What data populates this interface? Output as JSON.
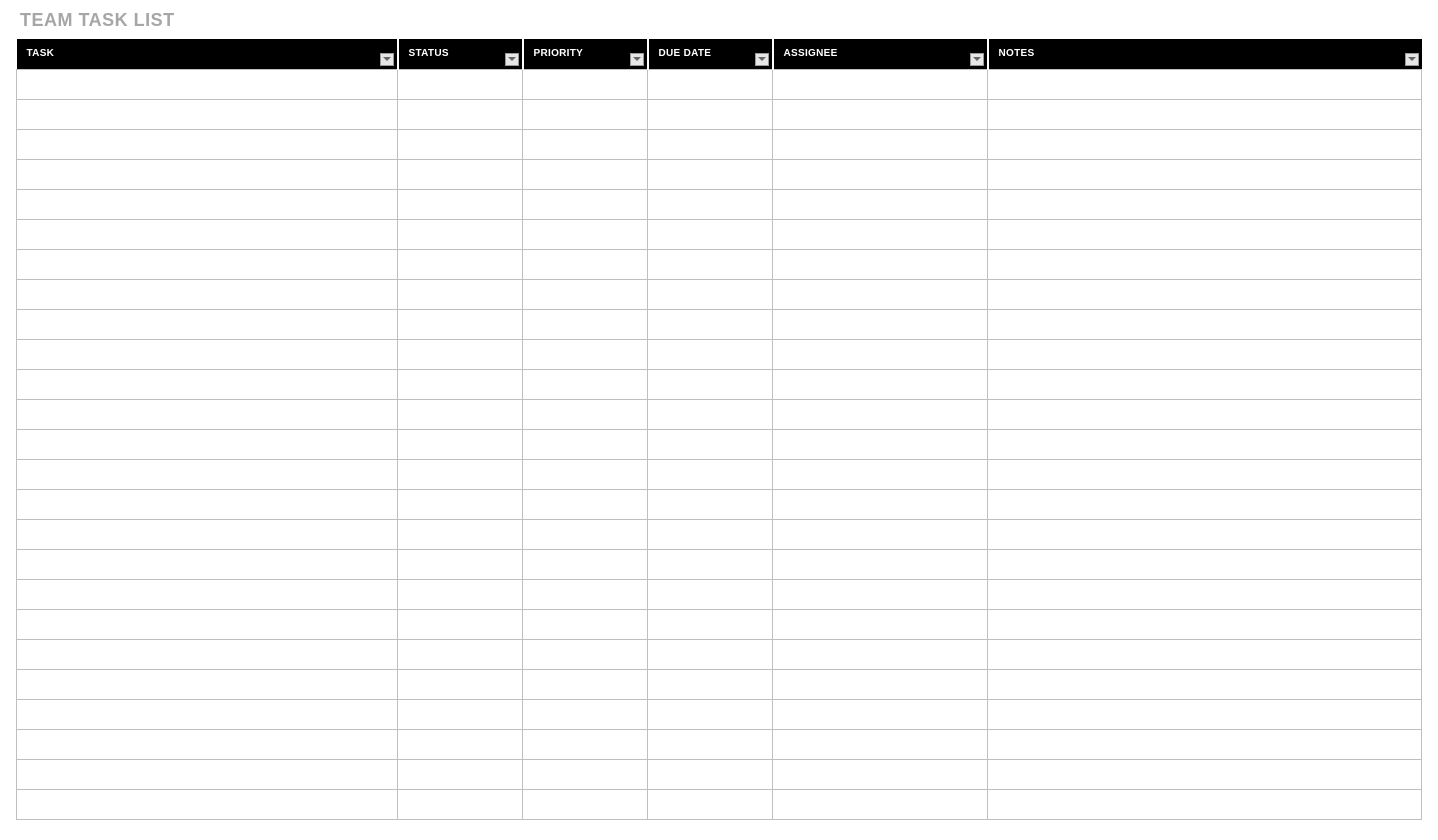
{
  "title": "TEAM TASK LIST",
  "columns": [
    {
      "key": "task",
      "label": "TASK",
      "filterable": true
    },
    {
      "key": "status",
      "label": "STATUS",
      "filterable": true
    },
    {
      "key": "priority",
      "label": "PRIORITY",
      "filterable": true
    },
    {
      "key": "due_date",
      "label": "DUE DATE",
      "filterable": true
    },
    {
      "key": "assignee",
      "label": "ASSIGNEE",
      "filterable": true
    },
    {
      "key": "notes",
      "label": "NOTES",
      "filterable": true
    }
  ],
  "rows": [
    {
      "task": "",
      "status": "",
      "priority": "",
      "due_date": "",
      "assignee": "",
      "notes": ""
    },
    {
      "task": "",
      "status": "",
      "priority": "",
      "due_date": "",
      "assignee": "",
      "notes": ""
    },
    {
      "task": "",
      "status": "",
      "priority": "",
      "due_date": "",
      "assignee": "",
      "notes": ""
    },
    {
      "task": "",
      "status": "",
      "priority": "",
      "due_date": "",
      "assignee": "",
      "notes": ""
    },
    {
      "task": "",
      "status": "",
      "priority": "",
      "due_date": "",
      "assignee": "",
      "notes": ""
    },
    {
      "task": "",
      "status": "",
      "priority": "",
      "due_date": "",
      "assignee": "",
      "notes": ""
    },
    {
      "task": "",
      "status": "",
      "priority": "",
      "due_date": "",
      "assignee": "",
      "notes": ""
    },
    {
      "task": "",
      "status": "",
      "priority": "",
      "due_date": "",
      "assignee": "",
      "notes": ""
    },
    {
      "task": "",
      "status": "",
      "priority": "",
      "due_date": "",
      "assignee": "",
      "notes": ""
    },
    {
      "task": "",
      "status": "",
      "priority": "",
      "due_date": "",
      "assignee": "",
      "notes": ""
    },
    {
      "task": "",
      "status": "",
      "priority": "",
      "due_date": "",
      "assignee": "",
      "notes": ""
    },
    {
      "task": "",
      "status": "",
      "priority": "",
      "due_date": "",
      "assignee": "",
      "notes": ""
    },
    {
      "task": "",
      "status": "",
      "priority": "",
      "due_date": "",
      "assignee": "",
      "notes": ""
    },
    {
      "task": "",
      "status": "",
      "priority": "",
      "due_date": "",
      "assignee": "",
      "notes": ""
    },
    {
      "task": "",
      "status": "",
      "priority": "",
      "due_date": "",
      "assignee": "",
      "notes": ""
    },
    {
      "task": "",
      "status": "",
      "priority": "",
      "due_date": "",
      "assignee": "",
      "notes": ""
    },
    {
      "task": "",
      "status": "",
      "priority": "",
      "due_date": "",
      "assignee": "",
      "notes": ""
    },
    {
      "task": "",
      "status": "",
      "priority": "",
      "due_date": "",
      "assignee": "",
      "notes": ""
    },
    {
      "task": "",
      "status": "",
      "priority": "",
      "due_date": "",
      "assignee": "",
      "notes": ""
    },
    {
      "task": "",
      "status": "",
      "priority": "",
      "due_date": "",
      "assignee": "",
      "notes": ""
    },
    {
      "task": "",
      "status": "",
      "priority": "",
      "due_date": "",
      "assignee": "",
      "notes": ""
    },
    {
      "task": "",
      "status": "",
      "priority": "",
      "due_date": "",
      "assignee": "",
      "notes": ""
    },
    {
      "task": "",
      "status": "",
      "priority": "",
      "due_date": "",
      "assignee": "",
      "notes": ""
    },
    {
      "task": "",
      "status": "",
      "priority": "",
      "due_date": "",
      "assignee": "",
      "notes": ""
    },
    {
      "task": "",
      "status": "",
      "priority": "",
      "due_date": "",
      "assignee": "",
      "notes": ""
    }
  ]
}
